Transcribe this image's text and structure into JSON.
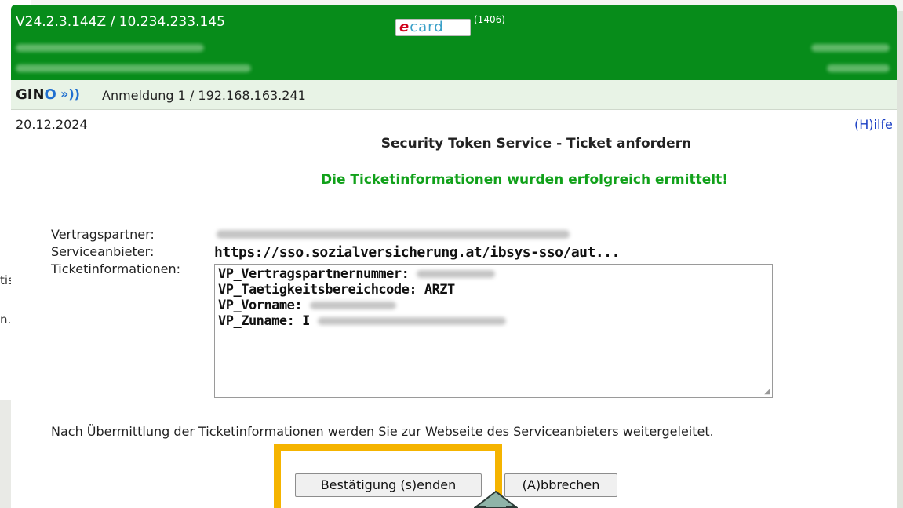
{
  "background": {
    "fragments": [
      "tis",
      "n."
    ]
  },
  "header": {
    "version": "V24.2.3.144Z / 10.234.233.145",
    "logo_text_prefix": "e",
    "logo_text": "card",
    "logo_code": "(1406)"
  },
  "gino": {
    "logo_prefix": "GIN",
    "logo_o": "O",
    "signal": "»))",
    "session": "Anmeldung 1 / 192.168.163.241"
  },
  "date": "20.12.2024",
  "help_link": "(H)ilfe",
  "title": "Security Token Service - Ticket anfordern",
  "success_message": "Die Ticketinformationen wurden erfolgreich ermittelt!",
  "form": {
    "partner_label": "Vertragspartner:",
    "service_label": "Serviceanbieter:",
    "service_value": "https://sso.sozialversicherung.at/ibsys-sso/aut...",
    "ticket_label": "Ticketinformationen:",
    "ticket_lines": [
      "VP_Vertragspartnernummer:",
      "VP_Taetigkeitsbereichcode: ARZT",
      "VP_Vorname:",
      "VP_Zuname: I"
    ]
  },
  "info_text": "Nach Übermittlung der Ticketinformationen werden Sie zur Webseite des Serviceanbieters weitergeleitet.",
  "buttons": {
    "send": "Bestätigung (s)enden",
    "cancel": "(A)bbrechen"
  },
  "colors": {
    "header_green": "#078c1a",
    "success_green": "#11a11a",
    "highlight": "#f5b400",
    "link": "#1a3fc4"
  },
  "icons": {
    "pointer": "arrow-up-icon",
    "signal": "signal-waves-icon"
  }
}
